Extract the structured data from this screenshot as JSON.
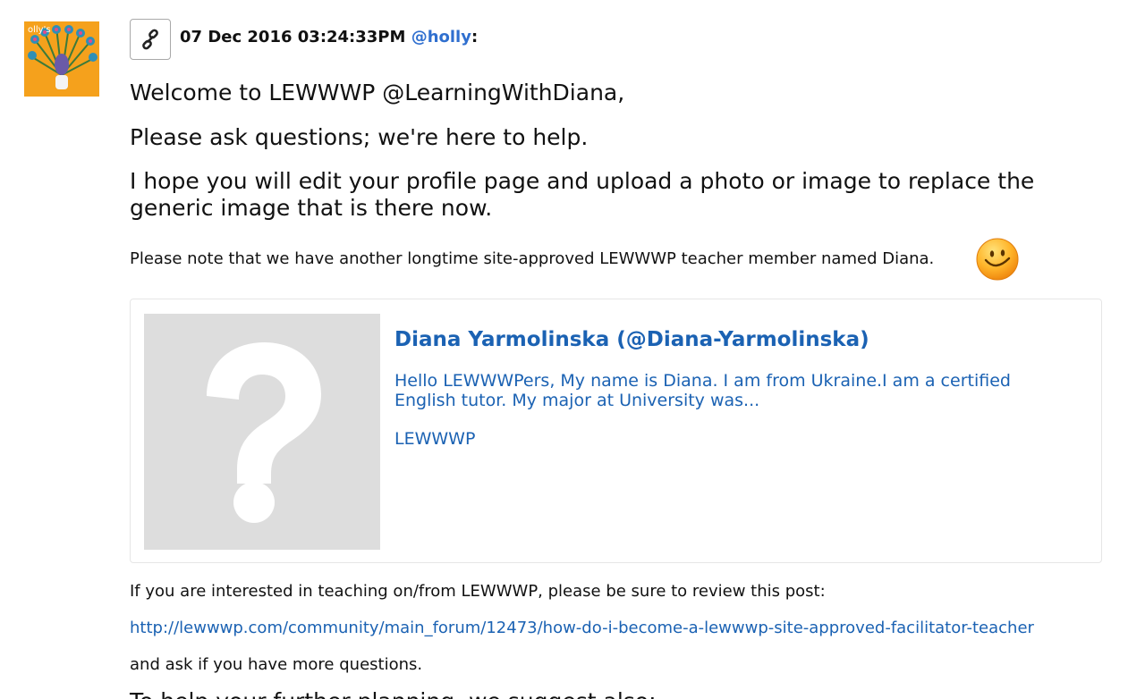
{
  "post": {
    "timestamp": "07 Dec 2016 03:24:33PM",
    "author": "@holly",
    "author_suffix": ":",
    "permalink_icon": "link-icon",
    "avatar_icon": "peacock-avatar"
  },
  "content": {
    "line1": "Welcome to LEWWWP @LearningWithDiana,",
    "line2": "Please ask questions; we're here to help.",
    "line3": "I hope you will edit your profile page and upload a photo or image to replace the generic image that is there now.",
    "note": "Please note that we have another longtime site-approved LEWWWP teacher member named Diana.",
    "emoji": "smiley-face-icon",
    "interest": "If you are interested in teaching on/from LEWWWP, please be sure to review this post:",
    "url": "http://lewwwp.com/community/main_forum/12473/how-do-i-become-a-lewwwp-site-approved-facilitator-teacher",
    "ask": "and ask if you have more questions.",
    "partial": "To help your further planning, we suggest also:"
  },
  "embed": {
    "title": "Diana Yarmolinska (@Diana-Yarmolinska)",
    "description": "Hello LEWWWPers,  My name is Diana. I am from Ukraine.I am a certified English tutor. My major at University was...",
    "site": "LEWWWP",
    "thumb_icon": "question-mark-icon"
  },
  "colors": {
    "link": "#1b62b3",
    "user": "#2f6fcf",
    "placeholder": "#dddddd"
  }
}
